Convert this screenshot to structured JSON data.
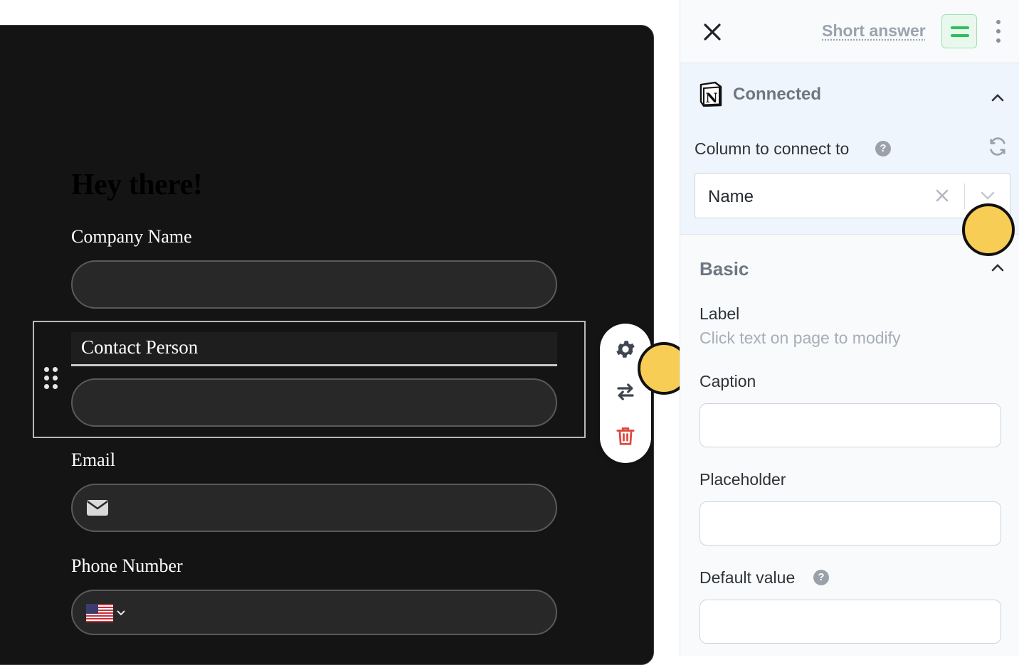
{
  "form": {
    "title": "Hey there!",
    "fields": [
      {
        "label": "Company Name",
        "value": ""
      },
      {
        "label": "Contact Person",
        "value": ""
      },
      {
        "label": "Email",
        "value": ""
      },
      {
        "label": "Phone Number",
        "value": ""
      }
    ]
  },
  "toolbar": {
    "icons": [
      "gear-icon",
      "swap-icon",
      "trash-icon"
    ],
    "colors": {
      "gear": "#3f4650",
      "swap": "#3f4650",
      "trash": "#e0473f"
    }
  },
  "panel": {
    "header": {
      "field_type": "Short answer",
      "type_icon": "short-answer-icon"
    },
    "connection": {
      "status": "Connected",
      "column_label": "Column to connect to",
      "column_value": "Name"
    },
    "basic": {
      "title": "Basic",
      "label_title": "Label",
      "label_hint": "Click text on page to modify",
      "caption_label": "Caption",
      "caption_value": "",
      "placeholder_label": "Placeholder",
      "placeholder_value": "",
      "default_label": "Default value",
      "default_value": ""
    }
  },
  "colors": {
    "accent_green": "#2fbf5f",
    "cursor_highlight": "#f7cd55",
    "form_background": "#141414"
  }
}
